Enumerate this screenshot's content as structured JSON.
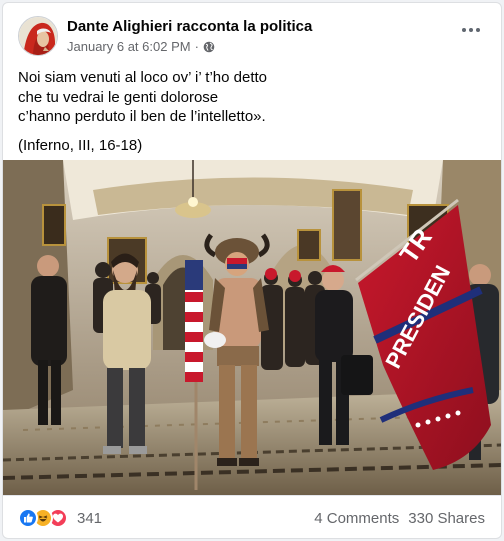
{
  "post": {
    "author": "Dante Alighieri racconta la politica",
    "timestamp": "January 6 at 6:02 PM",
    "separator": "·",
    "privacy_icon": "globe-icon",
    "menu_icon": "more-options-icon"
  },
  "body": {
    "lines": [
      "Noi siam venuti al loco ov’ i’ t’ho detto",
      "che tu vedrai le genti dolorose",
      "c’hanno perduto il ben de l’intelletto»."
    ],
    "citation": "(Inferno, III, 16-18)"
  },
  "photo": {
    "flag_text_top": "TR",
    "flag_text_main": "PRESIDEN"
  },
  "footer": {
    "reaction_icons": [
      "like-icon",
      "haha-icon",
      "love-icon"
    ],
    "reaction_count": "341",
    "comments": "4 Comments",
    "shares": "330 Shares"
  },
  "colors": {
    "like": "#1877f2",
    "haha": "#f7b125",
    "love": "#f33e58",
    "secondary_text": "#65676b"
  }
}
